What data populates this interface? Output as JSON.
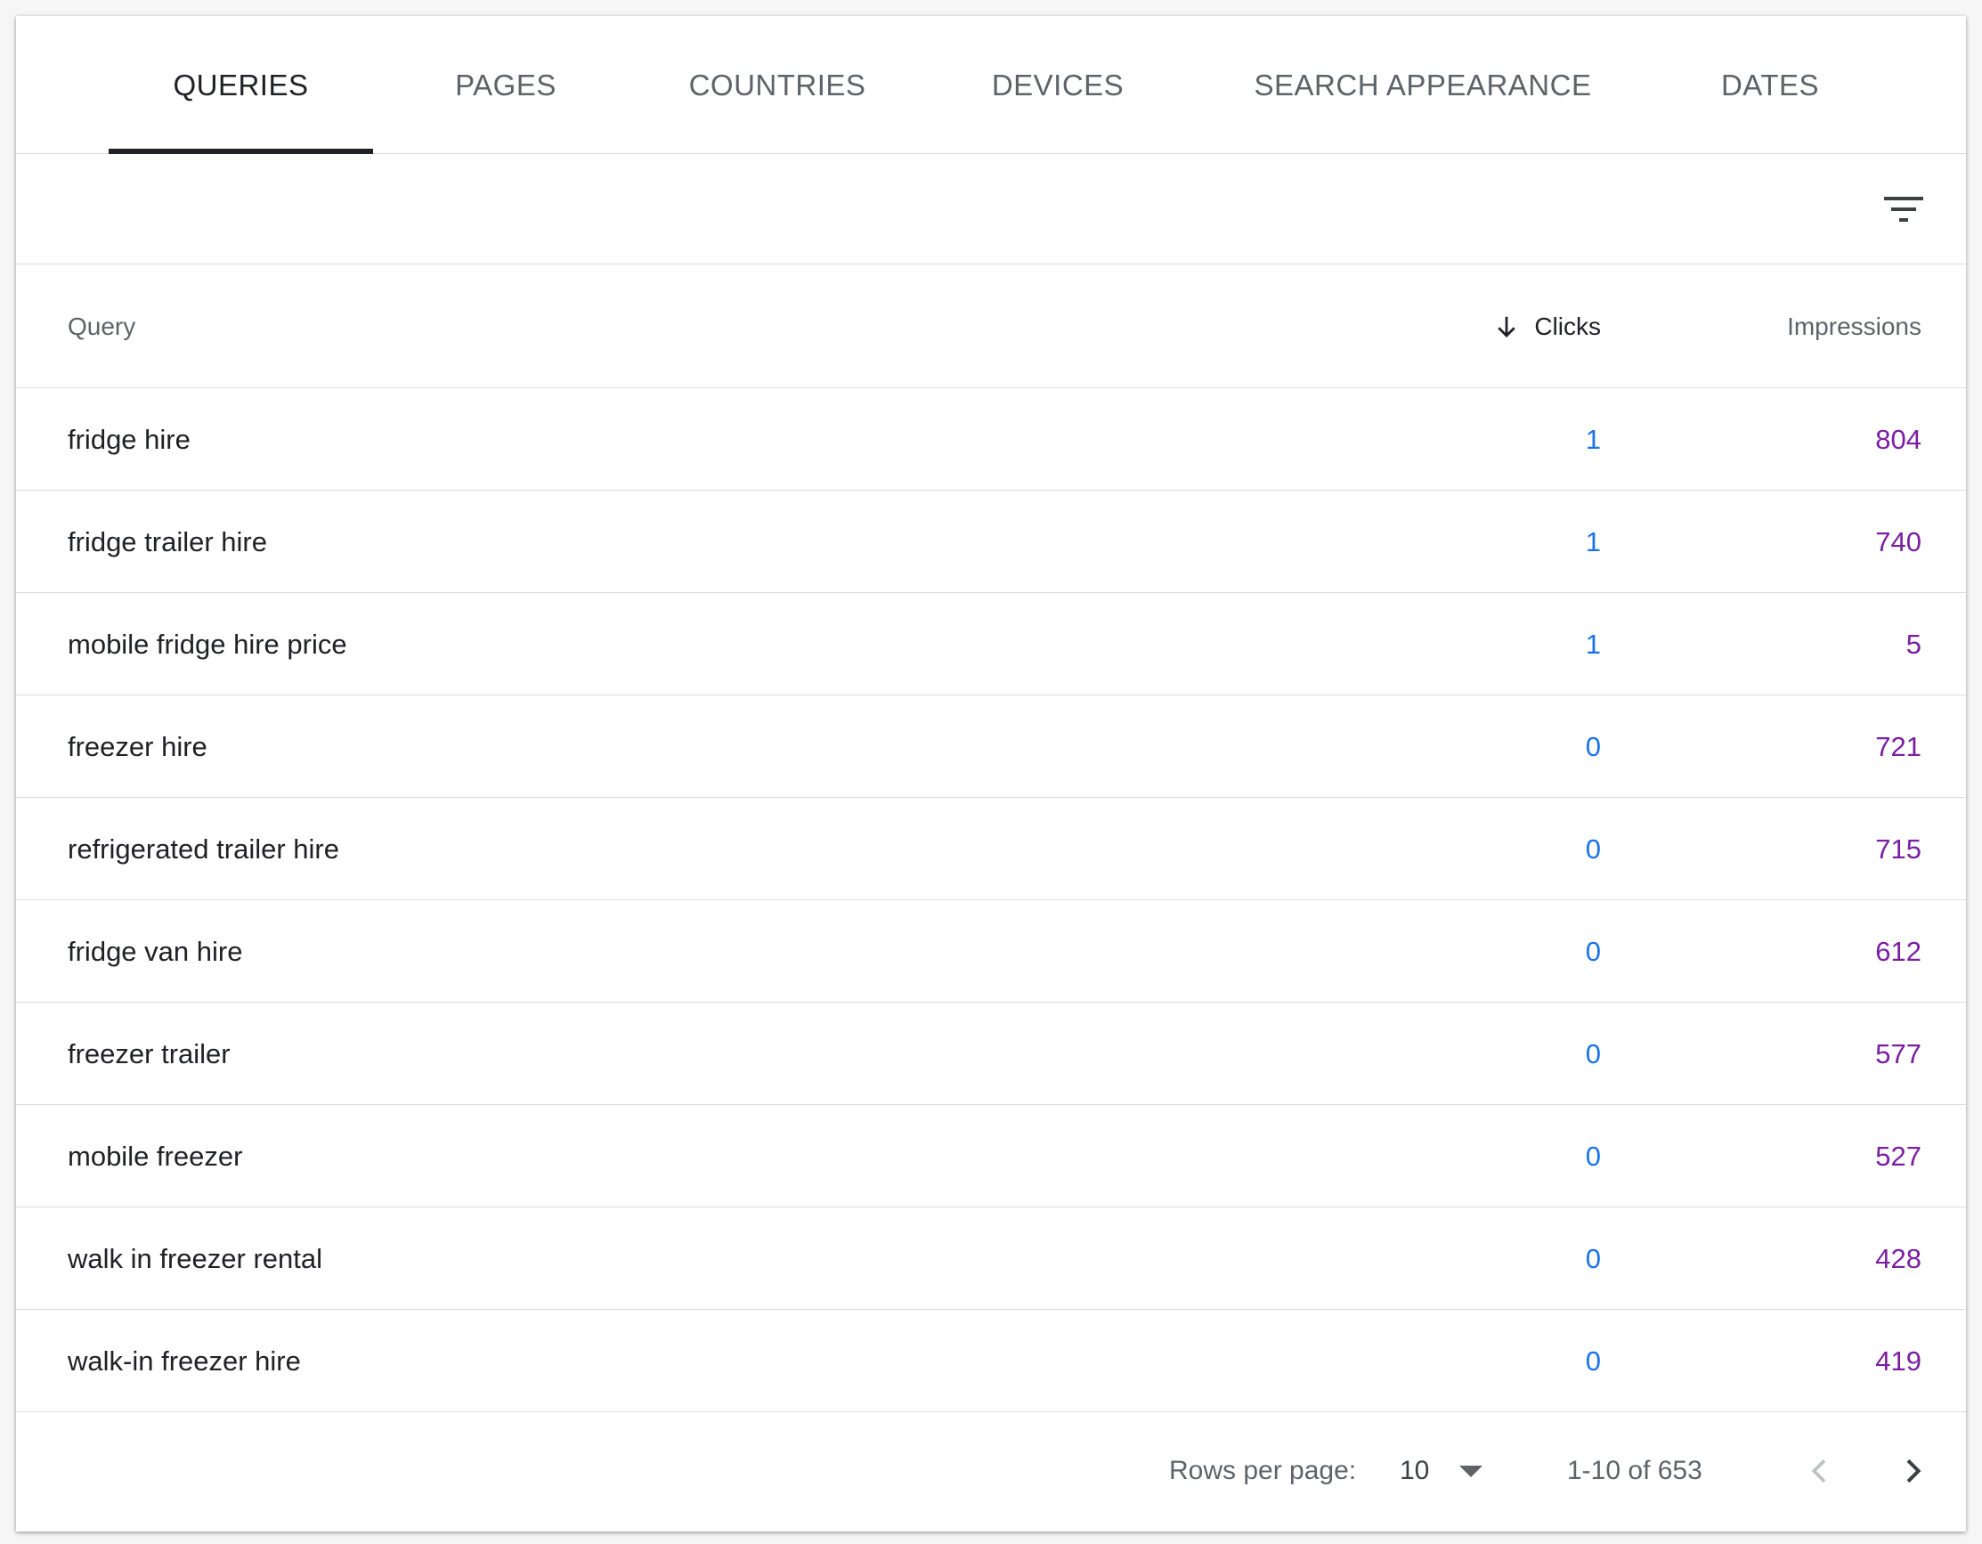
{
  "tabs": [
    {
      "label": "QUERIES",
      "active": true
    },
    {
      "label": "PAGES",
      "active": false
    },
    {
      "label": "COUNTRIES",
      "active": false
    },
    {
      "label": "DEVICES",
      "active": false
    },
    {
      "label": "SEARCH APPEARANCE",
      "active": false
    },
    {
      "label": "DATES",
      "active": false
    }
  ],
  "toolbar": {
    "filter_icon": "filter-list-icon"
  },
  "table": {
    "columns": {
      "query": "Query",
      "clicks": "Clicks",
      "impressions": "Impressions"
    },
    "sort": {
      "column": "clicks",
      "direction": "descending",
      "icon": "arrow-down-icon"
    },
    "rows": [
      {
        "query": "fridge hire",
        "clicks": "1",
        "impressions": "804"
      },
      {
        "query": "fridge trailer hire",
        "clicks": "1",
        "impressions": "740"
      },
      {
        "query": "mobile fridge hire price",
        "clicks": "1",
        "impressions": "5"
      },
      {
        "query": "freezer hire",
        "clicks": "0",
        "impressions": "721"
      },
      {
        "query": "refrigerated trailer hire",
        "clicks": "0",
        "impressions": "715"
      },
      {
        "query": "fridge van hire",
        "clicks": "0",
        "impressions": "612"
      },
      {
        "query": "freezer trailer",
        "clicks": "0",
        "impressions": "577"
      },
      {
        "query": "mobile freezer",
        "clicks": "0",
        "impressions": "527"
      },
      {
        "query": "walk in freezer rental",
        "clicks": "0",
        "impressions": "428"
      },
      {
        "query": "walk-in freezer hire",
        "clicks": "0",
        "impressions": "419"
      }
    ]
  },
  "pagination": {
    "rows_per_page_label": "Rows per page:",
    "rows_per_page_value": "10",
    "range_text": "1-10 of 653"
  },
  "colors": {
    "clicks": "#1a73e8",
    "impressions": "#7b1fa2",
    "active_tab": "#202124",
    "inactive_tab": "#5f6368",
    "divider": "#dadce0"
  }
}
